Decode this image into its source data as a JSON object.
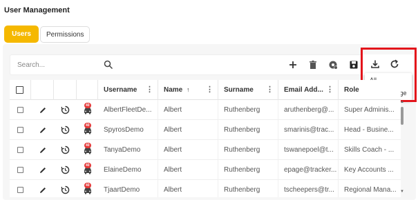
{
  "page": {
    "title": "User Management"
  },
  "tabs": [
    {
      "label": "Users",
      "active": true
    },
    {
      "label": "Permissions",
      "active": false
    }
  ],
  "toolbar": {
    "search_placeholder": "Search...",
    "icons": [
      "search-icon",
      "add-icon",
      "delete-icon",
      "settings-icon",
      "save-icon",
      "download-icon",
      "refresh-icon"
    ]
  },
  "export_menu": {
    "items": [
      "All",
      "Current Page"
    ]
  },
  "table": {
    "columns": [
      "Username",
      "Name",
      "Surname",
      "Email Add...",
      "Role"
    ],
    "sort_indicator": "↑",
    "badge_text": "40",
    "rows": [
      {
        "username": "AlbertFleetDe...",
        "name": "Albert",
        "surname": "Ruthenberg",
        "email": "aruthenberg@...",
        "role": "Super Adminis..."
      },
      {
        "username": "SpyrosDemo",
        "name": "Albert",
        "surname": "Ruthenberg",
        "email": "smarinis@trac...",
        "role": "Head - Busine..."
      },
      {
        "username": "TanyaDemo",
        "name": "Albert",
        "surname": "Ruthenberg",
        "email": "tswanepoel@t...",
        "role": "Skills Coach - ..."
      },
      {
        "username": "ElaineDemo",
        "name": "Albert",
        "surname": "Ruthenberg",
        "email": "epage@tracker...",
        "role": "Key Accounts ..."
      },
      {
        "username": "TjaartDemo",
        "name": "Albert",
        "surname": "Ruthenberg",
        "email": "tscheepers@tr...",
        "role": "Regional Mana..."
      }
    ]
  },
  "colors": {
    "accent": "#f5b800",
    "highlight": "#e3141b",
    "badge": "#e63a3a"
  }
}
